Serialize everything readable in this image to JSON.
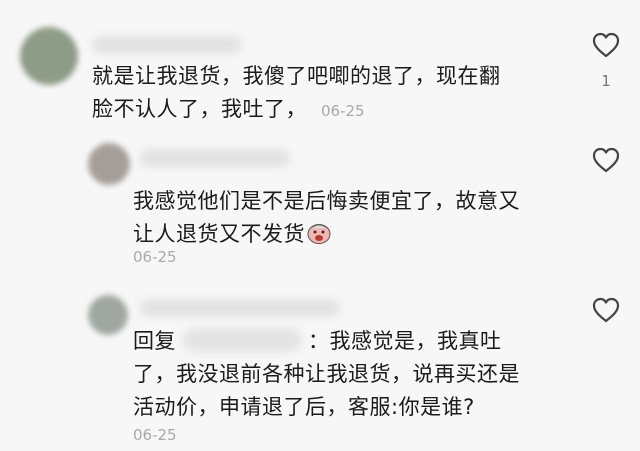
{
  "comments": [
    {
      "lines": [
        "就是让我退货，我傻了吧唧的退了，现在翻",
        "脸不认人了，我吐了，"
      ],
      "time": "06-25",
      "like_count": "1",
      "avatar_color": "#8e9b86"
    },
    {
      "lines": [
        "我感觉他们是不是后悔卖便宜了，故意又",
        "让人退货又不发货"
      ],
      "time": "06-25",
      "emoji": "crying-sticker",
      "avatar_color": "#a59e98"
    },
    {
      "reply_prefix": "回复",
      "reply_suffix": "：我感觉是，我真吐",
      "lines": [
        "了，我没退前各种让我退货，说再买还是",
        "活动价，申请退了后，客服:你是谁?"
      ],
      "time": "06-25",
      "avatar_color": "#a0a7a0"
    }
  ],
  "icons": {
    "like": "heart-outline-icon"
  },
  "colors": {
    "background": "#f7f7f7",
    "timestamp": "#a9a9a9",
    "icon": "#444444"
  }
}
